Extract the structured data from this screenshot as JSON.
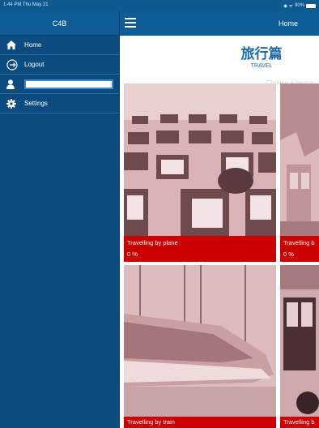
{
  "status_bar": {
    "time": "1:44 PM  Thu May 21",
    "battery": "90%"
  },
  "sidebar": {
    "title": "C4B",
    "items": [
      {
        "label": "Home",
        "icon": "home-icon"
      },
      {
        "label": "Logout",
        "icon": "logout-icon"
      },
      {
        "label": "",
        "icon": "user-icon"
      },
      {
        "label": "Settings",
        "icon": "gear-icon"
      }
    ]
  },
  "header": {
    "title": "Home"
  },
  "lesson": {
    "title_cn": "旅行篇",
    "title_en": "TRAVEL",
    "subtitle": "Choose a lesson"
  },
  "lessons": [
    {
      "title": "Travelling by plane",
      "progress": "0 %"
    },
    {
      "title": "Travelling b",
      "progress": "0 %"
    },
    {
      "title": "Travelling by train",
      "progress": ""
    },
    {
      "title": "Travelling b",
      "progress": ""
    }
  ],
  "colors": {
    "header": "#0e5c95",
    "sidebar": "#0b4b80",
    "accent_red": "#cc0000",
    "title_blue": "#1e6aa4"
  }
}
